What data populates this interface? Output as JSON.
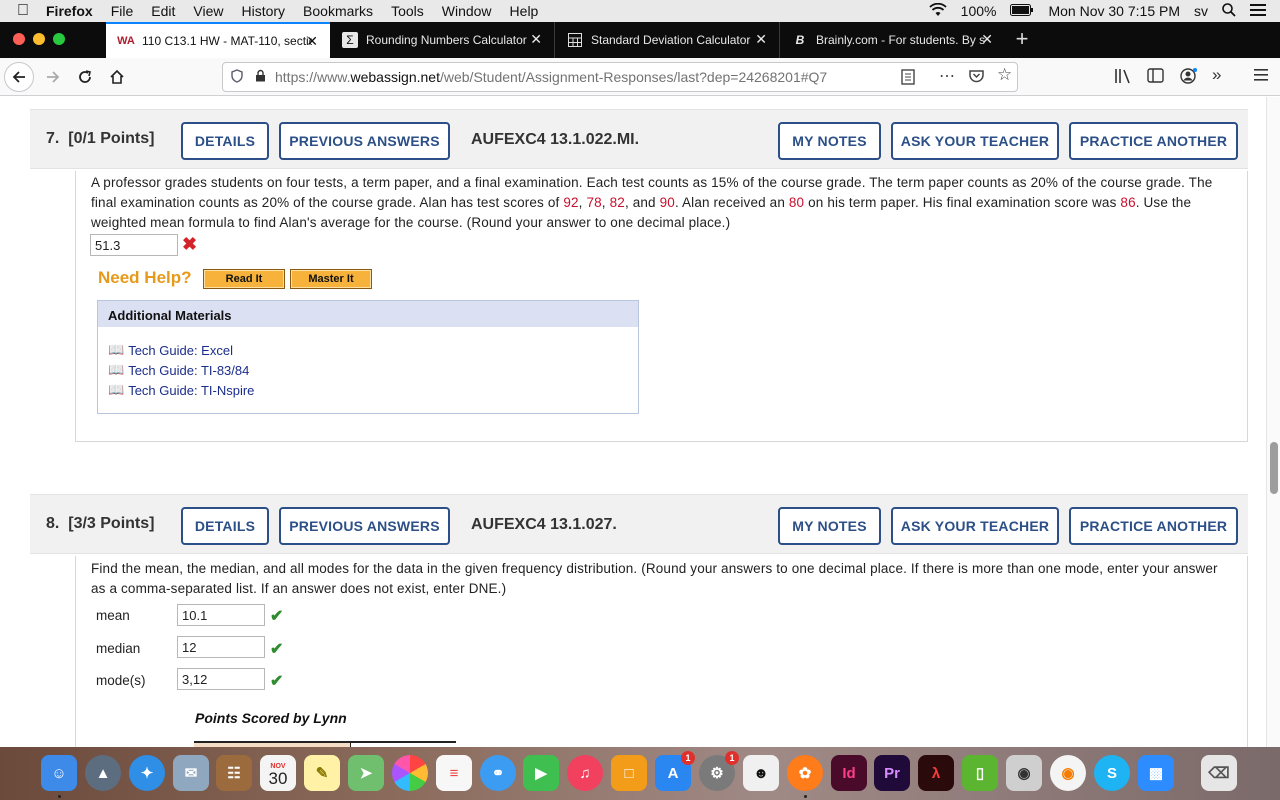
{
  "menubar": {
    "app": "Firefox",
    "items": [
      "File",
      "Edit",
      "View",
      "History",
      "Bookmarks",
      "Tools",
      "Window",
      "Help"
    ],
    "battery": "100%",
    "clock": "Mon Nov 30  7:15 PM",
    "user": "sv"
  },
  "tabs": [
    {
      "title": "110 C13.1 HW - MAT-110, sectio",
      "icon": "webassign-icon"
    },
    {
      "title": "Rounding Numbers Calculator",
      "icon": "sigma-icon"
    },
    {
      "title": "Standard Deviation Calculator",
      "icon": "calculator-icon"
    },
    {
      "title": "Brainly.com - For students. By s",
      "icon": "brainly-icon"
    }
  ],
  "url": {
    "prefix": "https://www.",
    "domain": "webassign.net",
    "path": "/web/Student/Assignment-Responses/last?dep=24268201#Q7"
  },
  "buttons": {
    "details": "DETAILS",
    "previous_answers": "PREVIOUS ANSWERS",
    "my_notes": "MY NOTES",
    "ask_teacher": "ASK YOUR TEACHER",
    "practice_another": "PRACTICE ANOTHER"
  },
  "q7": {
    "number": "7.",
    "points": "[0/1 Points]",
    "code": "AUFEXC4 13.1.022.MI.",
    "text_parts": [
      "A professor grades students on four tests, a term paper, and a final examination. Each test counts as 15% of the course grade. The term paper counts as 20% of the course grade. The final examination counts as 20% of the course grade. Alan has test scores of ",
      "92",
      ", ",
      "78",
      ", ",
      "82",
      ", and ",
      "90",
      ". Alan received an ",
      "80",
      " on his term paper. His final examination score was ",
      "86",
      ". Use the weighted mean formula to find Alan's average for the course. (Round your answer to one decimal place.)"
    ],
    "answer": "51.3",
    "need_help": "Need Help?",
    "read_it": "Read It",
    "master_it": "Master It",
    "additional_materials": "Additional Materials",
    "materials": [
      "Tech Guide: Excel",
      "Tech Guide: TI-83/84",
      "Tech Guide: TI-Nspire"
    ]
  },
  "q8": {
    "number": "8.",
    "points": "[3/3 Points]",
    "code": "AUFEXC4 13.1.027.",
    "text": "Find the mean, the median, and all modes for the data in the given frequency distribution. (Round your answers to one decimal place. If there is more than one mode, enter your answer as a comma-separated list. If an answer does not exist, enter DNE.)",
    "fields": [
      {
        "label": "mean",
        "value": "10.1"
      },
      {
        "label": "median",
        "value": "12"
      },
      {
        "label": "mode(s)",
        "value": "3,12"
      }
    ],
    "table_title": "Points Scored by Lynn"
  },
  "dock": {
    "calendar_month": "NOV",
    "calendar_day": "30",
    "badge_appstore": "1",
    "badge_prefs": "1"
  }
}
